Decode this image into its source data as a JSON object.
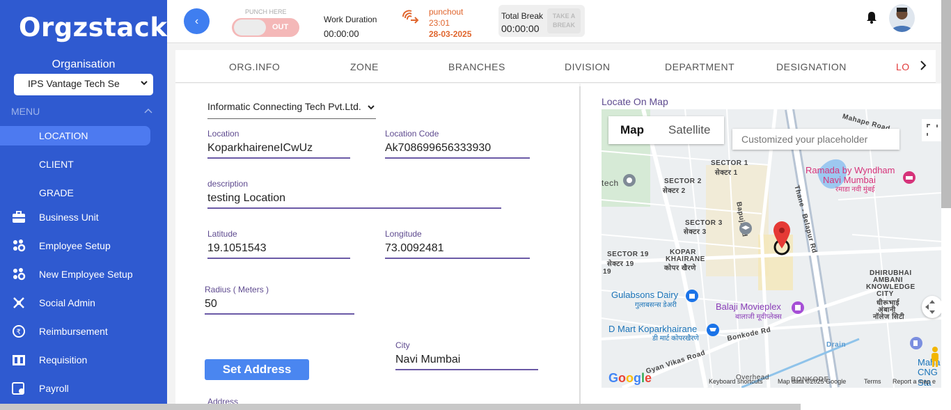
{
  "app": {
    "logo": "Orgzstack"
  },
  "sidebar": {
    "org_label": "Organisation",
    "org_selected": "IPS Vantage Tech Se",
    "menu_label": "MENU",
    "sub_items": [
      {
        "label": "LOCATION",
        "active": true
      },
      {
        "label": "CLIENT"
      },
      {
        "label": "GRADE"
      }
    ],
    "items": [
      {
        "label": "Business Unit",
        "icon": "briefcase-icon"
      },
      {
        "label": "Employee Setup",
        "icon": "people-gear-icon"
      },
      {
        "label": "New Employee Setup",
        "icon": "people-gear-icon"
      },
      {
        "label": "Social Admin",
        "icon": "social-icon"
      },
      {
        "label": "Reimbursement",
        "icon": "rupee-icon"
      },
      {
        "label": "Requisition",
        "icon": "requisition-icon"
      },
      {
        "label": "Payroll",
        "icon": "payroll-icon"
      }
    ]
  },
  "header": {
    "punch_here": "PUNCH HERE",
    "toggle_label": "OUT",
    "work_duration_label": "Work Duration",
    "work_duration_value": "00:00:00",
    "punchout_label": "punchout",
    "punchout_time": "23:01",
    "punchout_date": "28-03-2025",
    "total_break_label": "Total Break",
    "total_break_value": "00:00:00",
    "take_break_line1": "TAKE A",
    "take_break_line2": "BREAK"
  },
  "tabs": [
    "ORG.INFO",
    "ZONE",
    "BRANCHES",
    "DIVISION",
    "DEPARTMENT",
    "DESIGNATION",
    "LO"
  ],
  "form": {
    "company": "Informatic Connecting Tech Pvt.Ltd.",
    "location_label": "Location",
    "location_value": "KoparkhaireneICwUz",
    "location_code_label": "Location Code",
    "location_code_value": "Ak708699656333930",
    "description_label": "description",
    "description_value": "testing Location",
    "latitude_label": "Latitude",
    "latitude_value": "19.1051543",
    "longitude_label": "Longitude",
    "longitude_value": "73.0092481",
    "radius_label": "Radius ( Meters )",
    "radius_value": "50",
    "city_label": "City",
    "city_value": "Navi Mumbai",
    "set_address_label": "Set Address",
    "address_label": "Address"
  },
  "map": {
    "title": "Locate On Map",
    "tab_map": "Map",
    "tab_satellite": "Satellite",
    "search_placeholder": "Customized your placeholder",
    "google": "Google",
    "footer": [
      "Keyboard shortcuts",
      "Map data ©2025 Google",
      "Terms",
      "Report a map e"
    ],
    "labels": [
      {
        "text": "SECTOR 1"
      },
      {
        "text": "सेक्टर 1"
      },
      {
        "text": "SECTOR 2"
      },
      {
        "text": "सेक्टर 2"
      },
      {
        "text": "SECTOR 3"
      },
      {
        "text": "सेक्टर 3"
      },
      {
        "text": "SECTOR 19"
      },
      {
        "text": "सेक्टर 19"
      },
      {
        "text": "KOPAR"
      },
      {
        "text": "KHAIRANE"
      },
      {
        "text": "कोपर खैरणे"
      },
      {
        "text": "DHIRUBHAI"
      },
      {
        "text": "AMBANI"
      },
      {
        "text": "KNOWLEDGE"
      },
      {
        "text": "CITY"
      },
      {
        "text": "धीरूभाई"
      },
      {
        "text": "अंबानी"
      },
      {
        "text": "नॉलेज सिटी"
      },
      {
        "text": "Bapuji Rd"
      },
      {
        "text": "Thane - Belapur Rd"
      },
      {
        "text": "Bonkode Rd"
      },
      {
        "text": "Gyan Vikas Road"
      },
      {
        "text": "Drain"
      },
      {
        "text": "Mahape Road"
      },
      {
        "text": "tech"
      },
      {
        "text": "BONKODE"
      },
      {
        "text": "Overhead"
      },
      {
        "text": "19"
      }
    ],
    "pois": [
      {
        "text": "Ramada by Wyndham",
        "color": "#d6337a"
      },
      {
        "text": "Navi Mumbai",
        "color": "#d6337a"
      },
      {
        "text": "रमाडा नवी मुंबई",
        "color": "#d6337a"
      },
      {
        "text": "Gulabsons Dairy",
        "color": "#1a73b8"
      },
      {
        "text": "गुलाबसन्स डेअरी",
        "color": "#1a73b8"
      },
      {
        "text": "Balaji Movieplex",
        "color": "#8b3fb8"
      },
      {
        "text": "बालाजी मूवीप्लेक्स",
        "color": "#8b3fb8"
      },
      {
        "text": "D Mart Koparkhairane",
        "color": "#1a73b8"
      },
      {
        "text": "डी मार्ट कोपरखैरणे",
        "color": "#1a73b8"
      },
      {
        "text": "Maha",
        "color": "#1a73b8"
      },
      {
        "text": "CNG Sta",
        "color": "#1a73b8"
      }
    ]
  }
}
